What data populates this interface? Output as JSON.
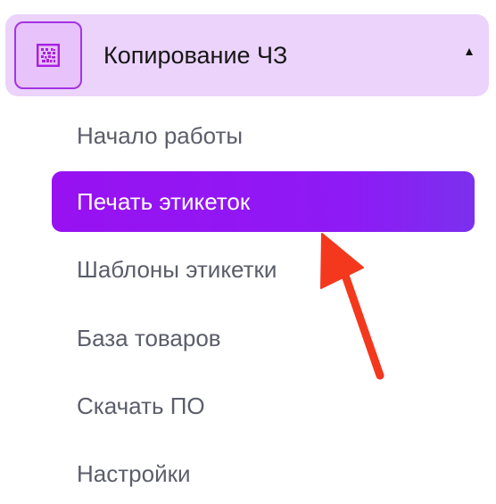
{
  "section": {
    "title": "Копирование ЧЗ",
    "icon": "datamatrix-code-icon",
    "expanded": true
  },
  "menu": {
    "items": [
      {
        "id": "start",
        "label": "Начало работы",
        "active": false
      },
      {
        "id": "print-labels",
        "label": "Печать этикеток",
        "active": true
      },
      {
        "id": "label-templates",
        "label": "Шаблоны этикетки",
        "active": false
      },
      {
        "id": "product-base",
        "label": "База товаров",
        "active": false
      },
      {
        "id": "download-software",
        "label": "Скачать ПО",
        "active": false
      },
      {
        "id": "settings",
        "label": "Настройки",
        "active": false
      }
    ]
  },
  "colors": {
    "header_bg": "#ebd3fb",
    "icon_border": "#a334e3",
    "active_start": "#9811f1",
    "active_end": "#7b30ee",
    "item_text": "#5b5e6a",
    "arrow": "#f4381e"
  }
}
